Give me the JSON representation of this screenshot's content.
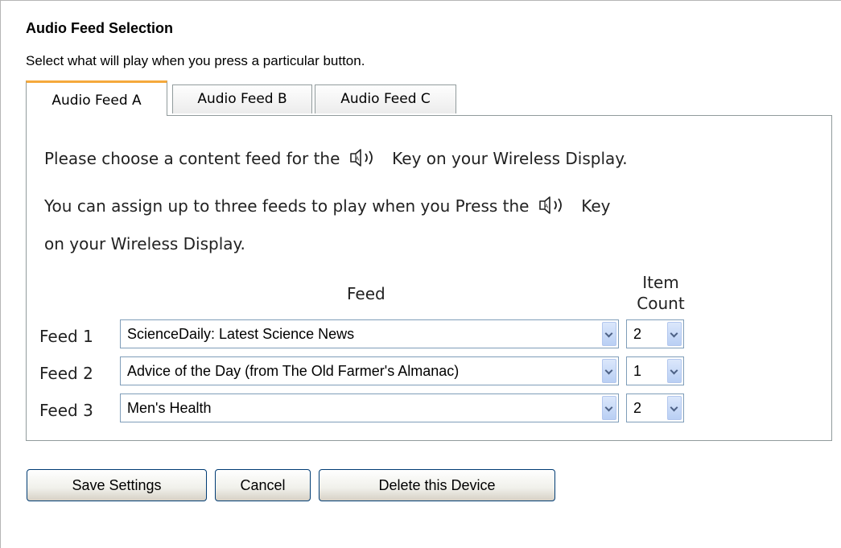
{
  "section": {
    "title": "Audio Feed Selection",
    "description": "Select what will play when you press a particular button."
  },
  "tabs": [
    {
      "label": "Audio Feed A",
      "active": true
    },
    {
      "label": "Audio Feed B",
      "active": false
    },
    {
      "label": "Audio Feed C",
      "active": false
    }
  ],
  "panel": {
    "line1_before": "Please choose a content feed for the",
    "line1_after": "Key on your Wireless Display.",
    "line2_before": "You can assign up to three feeds to play when you Press the",
    "line2_after": "Key",
    "line3": "on your Wireless Display.",
    "key_icon": "speaker-key-icon"
  },
  "table": {
    "feed_header": "Feed",
    "count_header_line1": "Item",
    "count_header_line2": "Count",
    "rows": [
      {
        "label": "Feed 1",
        "feed": "ScienceDaily: Latest Science News",
        "count": "2"
      },
      {
        "label": "Feed 2",
        "feed": "Advice of the Day (from The Old Farmer's Almanac)",
        "count": "1"
      },
      {
        "label": "Feed 3",
        "feed": "Men's Health",
        "count": "2"
      }
    ]
  },
  "buttons": {
    "save": "Save Settings",
    "cancel": "Cancel",
    "delete": "Delete this Device"
  },
  "colors": {
    "active_tab_accent": "#f5a93c",
    "select_border": "#7f9db9",
    "button_border": "#003c74"
  }
}
